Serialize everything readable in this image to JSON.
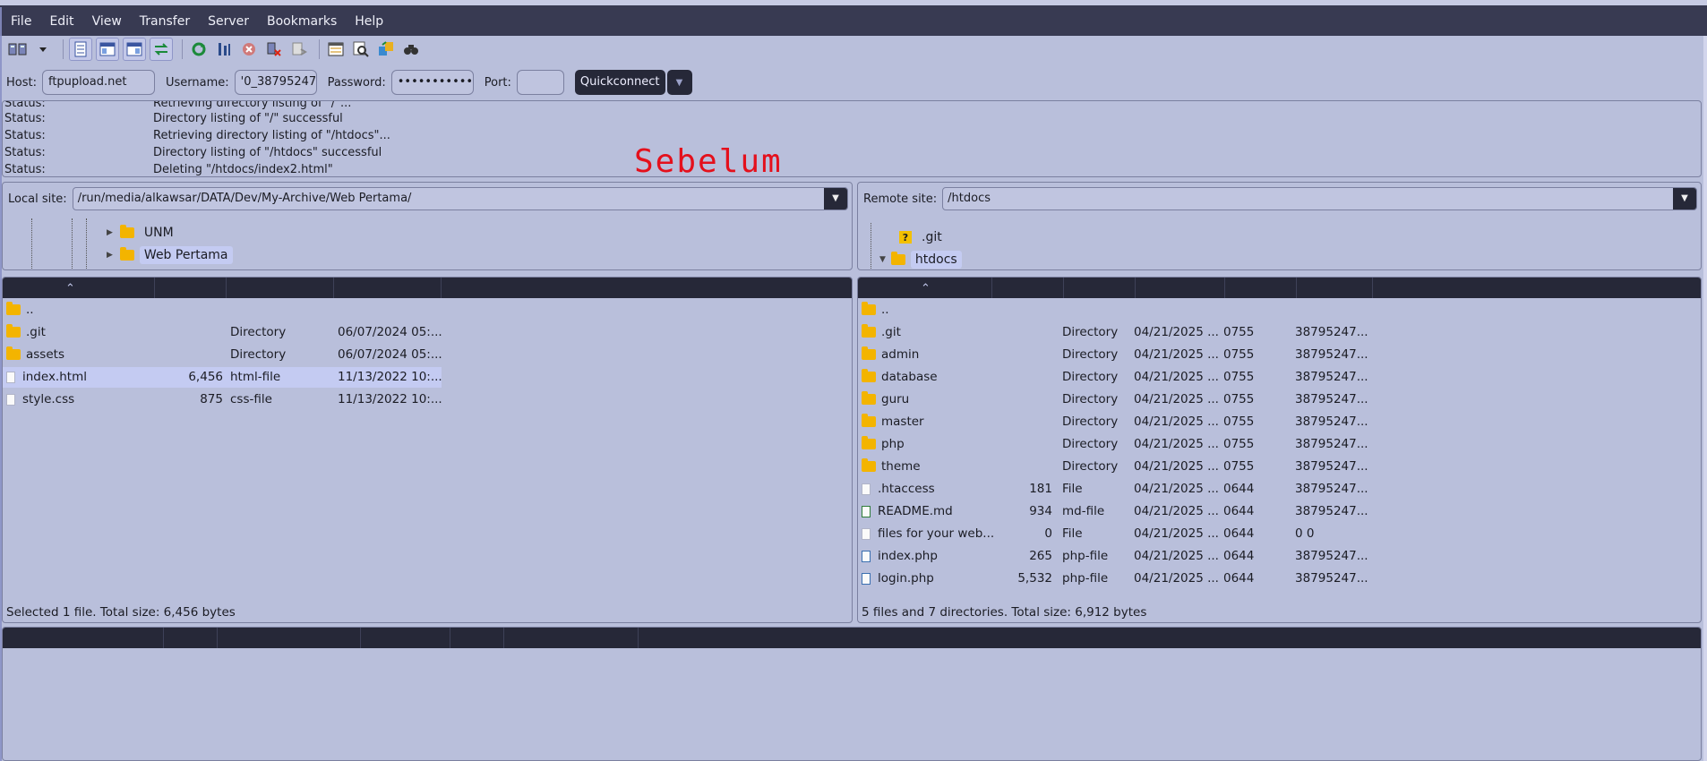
{
  "menu": [
    "File",
    "Edit",
    "View",
    "Transfer",
    "Server",
    "Bookmarks",
    "Help"
  ],
  "toolbar_icons": [
    "site-manager-icon",
    "dropdown-arrow-icon",
    "message-log-icon",
    "local-tree-icon",
    "remote-tree-icon",
    "queue-icon",
    "refresh-icon",
    "process-queue-icon",
    "cancel-icon",
    "disconnect-icon",
    "reconnect-icon",
    "filter-icon",
    "search-remote-icon",
    "compare-icon",
    "find-icon"
  ],
  "connection": {
    "host_label": "Host:",
    "host_value": "ftpupload.net",
    "username_label": "Username:",
    "username_value": "'0_38795247",
    "password_label": "Password:",
    "password_value": "••••••••••••",
    "port_label": "Port:",
    "port_value": "",
    "quickconnect": "Quickconnect"
  },
  "log": [
    {
      "k": "Status:",
      "v": "Retrieving directory listing of \"/\"..."
    },
    {
      "k": "Status:",
      "v": "Directory listing of \"/\" successful"
    },
    {
      "k": "Status:",
      "v": "Retrieving directory listing of \"/htdocs\"..."
    },
    {
      "k": "Status:",
      "v": "Directory listing of \"/htdocs\" successful"
    },
    {
      "k": "Status:",
      "v": "Deleting \"/htdocs/index2.html\""
    }
  ],
  "overlay_text": "Sebelum",
  "local": {
    "site_label": "Local site:",
    "path": "/run/media/alkawsar/DATA/Dev/My-Archive/Web Pertama/",
    "tree": [
      "UNM",
      "Web Pertama"
    ],
    "files": [
      {
        "name": "..",
        "size": "",
        "type": "",
        "date": "",
        "kind": "folder"
      },
      {
        "name": ".git",
        "size": "",
        "type": "Directory",
        "date": "06/07/2024 05:...",
        "kind": "folder"
      },
      {
        "name": "assets",
        "size": "",
        "type": "Directory",
        "date": "06/07/2024 05:...",
        "kind": "folder"
      },
      {
        "name": "index.html",
        "size": "6,456",
        "type": "html-file",
        "date": "11/13/2022 10:...",
        "kind": "file"
      },
      {
        "name": "style.css",
        "size": "875",
        "type": "css-file",
        "date": "11/13/2022 10:...",
        "kind": "file"
      }
    ],
    "status": "Selected 1 file. Total size: 6,456 bytes"
  },
  "remote": {
    "site_label": "Remote site:",
    "path": "/htdocs",
    "tree": [
      ".git",
      "htdocs"
    ],
    "files": [
      {
        "name": "..",
        "size": "",
        "type": "",
        "date": "",
        "perm": "",
        "owner": "",
        "kind": "folder"
      },
      {
        "name": ".git",
        "size": "",
        "type": "Directory",
        "date": "04/21/2025 ...",
        "perm": "0755",
        "owner": "38795247...",
        "kind": "folder"
      },
      {
        "name": "admin",
        "size": "",
        "type": "Directory",
        "date": "04/21/2025 ...",
        "perm": "0755",
        "owner": "38795247...",
        "kind": "folder"
      },
      {
        "name": "database",
        "size": "",
        "type": "Directory",
        "date": "04/21/2025 ...",
        "perm": "0755",
        "owner": "38795247...",
        "kind": "folder"
      },
      {
        "name": "guru",
        "size": "",
        "type": "Directory",
        "date": "04/21/2025 ...",
        "perm": "0755",
        "owner": "38795247...",
        "kind": "folder"
      },
      {
        "name": "master",
        "size": "",
        "type": "Directory",
        "date": "04/21/2025 ...",
        "perm": "0755",
        "owner": "38795247...",
        "kind": "folder"
      },
      {
        "name": "php",
        "size": "",
        "type": "Directory",
        "date": "04/21/2025 ...",
        "perm": "0755",
        "owner": "38795247...",
        "kind": "folder"
      },
      {
        "name": "theme",
        "size": "",
        "type": "Directory",
        "date": "04/21/2025 ...",
        "perm": "0755",
        "owner": "38795247...",
        "kind": "folder"
      },
      {
        "name": ".htaccess",
        "size": "181",
        "type": "File",
        "date": "04/21/2025 ...",
        "perm": "0644",
        "owner": "38795247...",
        "kind": "file"
      },
      {
        "name": "README.md",
        "size": "934",
        "type": "md-file",
        "date": "04/21/2025 ...",
        "perm": "0644",
        "owner": "38795247...",
        "kind": "md"
      },
      {
        "name": "files for your web...",
        "size": "0",
        "type": "File",
        "date": "04/21/2025 ...",
        "perm": "0644",
        "owner": "0 0",
        "kind": "file"
      },
      {
        "name": "index.php",
        "size": "265",
        "type": "php-file",
        "date": "04/21/2025 ...",
        "perm": "0644",
        "owner": "38795247...",
        "kind": "php"
      },
      {
        "name": "login.php",
        "size": "5,532",
        "type": "php-file",
        "date": "04/21/2025 ...",
        "perm": "0644",
        "owner": "38795247...",
        "kind": "php"
      }
    ],
    "status": "5 files and 7 directories. Total size: 6,912 bytes"
  }
}
